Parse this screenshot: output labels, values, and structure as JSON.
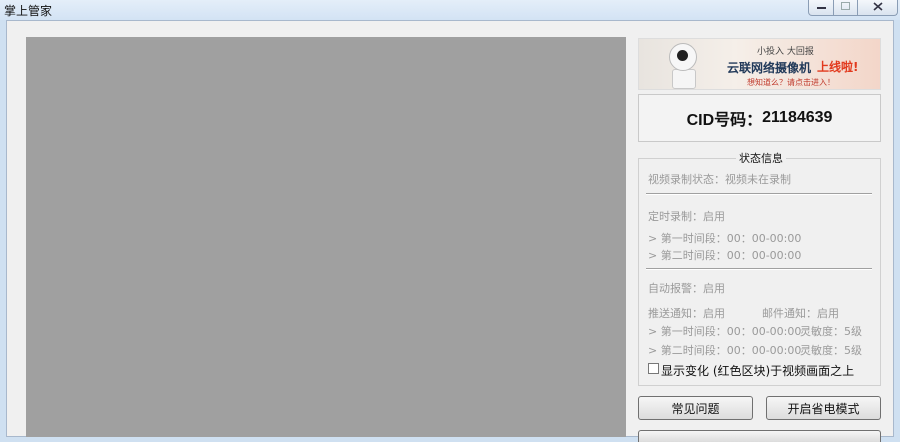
{
  "window": {
    "title": "掌上管家",
    "minimize_icon": "minimize-icon",
    "maximize_icon": "maximize-icon",
    "close_icon": "close-icon"
  },
  "banner": {
    "small_text": "小投入 大回报",
    "main_text": "云联网络摄像机",
    "highlight_text": "上线啦!",
    "sub_text": "想知道么？请点击进入！",
    "accent_color": "#e23a1e"
  },
  "cid": {
    "label": "CID号码：",
    "value": "21184639"
  },
  "status": {
    "title": "状态信息",
    "video_record": "视频录制状态：视频未在录制",
    "timer_record": "定时录制：启用",
    "timer_period1": "> 第一时间段：00：00-00:00",
    "timer_period2": "> 第二时间段：00：00-00:00",
    "auto_alarm": "自动报警：启用",
    "push_notify": "推送通知：启用",
    "mail_notify": "邮件通知：启用",
    "alarm_period1": "> 第一时间段：00：00-00:00",
    "alarm_period2": "> 第二时间段：00：00-00:00",
    "sensitivity1": "灵敏度：5级",
    "sensitivity2": "灵敏度：5级"
  },
  "options": {
    "show_change_label": "显示变化 (红色区块)于视频画面之上",
    "show_change_checked": false
  },
  "buttons": {
    "faq": "常见问题",
    "power_save": "开启省电模式"
  }
}
